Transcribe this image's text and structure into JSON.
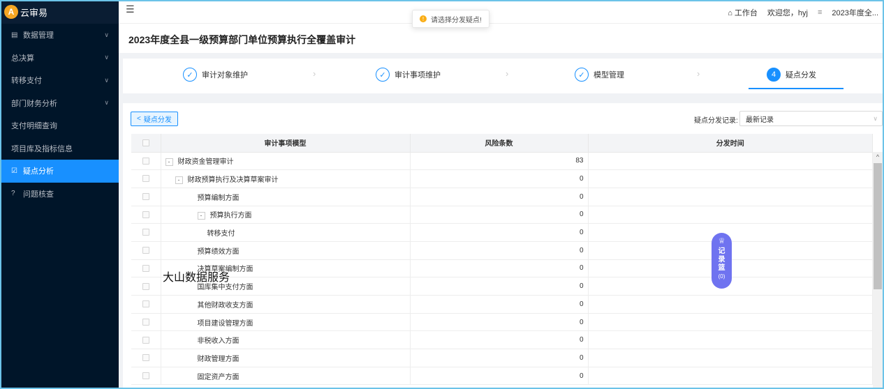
{
  "app": {
    "logo_text": "云审易"
  },
  "sidebar": {
    "items": [
      {
        "label": "数据管理",
        "icon": "▤",
        "has_children": true,
        "active": false
      },
      {
        "label": "总决算",
        "icon": "",
        "has_children": true,
        "active": false
      },
      {
        "label": "转移支付",
        "icon": "",
        "has_children": true,
        "active": false
      },
      {
        "label": "部门财务分析",
        "icon": "",
        "has_children": true,
        "active": false
      },
      {
        "label": "支付明细查询",
        "icon": "",
        "has_children": false,
        "active": false
      },
      {
        "label": "项目库及指标信息",
        "icon": "",
        "has_children": false,
        "active": false
      },
      {
        "label": "疑点分析",
        "icon": "☑",
        "has_children": false,
        "active": true
      },
      {
        "label": "问题核查",
        "icon": "?",
        "has_children": false,
        "active": false
      }
    ]
  },
  "topbar": {
    "workbench": "工作台",
    "welcome": "欢迎您，hyj",
    "year": "2023年度全..."
  },
  "toast": {
    "message": "请选择分发疑点!"
  },
  "page": {
    "title": "2023年度全县一级预算部门单位预算执行全覆盖审计"
  },
  "steps": [
    {
      "label": "审计对象维护",
      "marker": "✓",
      "active": false
    },
    {
      "label": "审计事项维护",
      "marker": "✓",
      "active": false
    },
    {
      "label": "模型管理",
      "marker": "✓",
      "active": false
    },
    {
      "label": "疑点分发",
      "marker": "4",
      "active": true
    }
  ],
  "toolbar": {
    "dispatch_button": "疑点分发",
    "record_label": "疑点分发记录:",
    "record_select_value": "最新记录"
  },
  "table": {
    "headers": [
      "审计事项模型",
      "风险条数",
      "分发时间"
    ],
    "rows": [
      {
        "name": "财政资金管理审计",
        "level": 0,
        "toggle": "-",
        "risk": "83",
        "time": ""
      },
      {
        "name": "财政预算执行及决算草案审计",
        "level": 1,
        "toggle": "-",
        "risk": "0",
        "time": ""
      },
      {
        "name": "预算编制方面",
        "level": 2,
        "toggle": "",
        "risk": "0",
        "time": ""
      },
      {
        "name": "预算执行方面",
        "level": 2,
        "toggle": "-",
        "risk": "0",
        "time": ""
      },
      {
        "name": "转移支付",
        "level": 3,
        "toggle": "",
        "risk": "0",
        "time": ""
      },
      {
        "name": "预算绩效方面",
        "level": 2,
        "toggle": "",
        "risk": "0",
        "time": ""
      },
      {
        "name": "决算草案编制方面",
        "level": 2,
        "toggle": "",
        "risk": "0",
        "time": ""
      },
      {
        "name": "国库集中支付方面",
        "level": 2,
        "toggle": "",
        "risk": "0",
        "time": ""
      },
      {
        "name": "其他财政收支方面",
        "level": 2,
        "toggle": "",
        "risk": "0",
        "time": ""
      },
      {
        "name": "项目建设管理方面",
        "level": 2,
        "toggle": "",
        "risk": "0",
        "time": ""
      },
      {
        "name": "非税收入方面",
        "level": 2,
        "toggle": "",
        "risk": "0",
        "time": ""
      },
      {
        "name": "财政管理方面",
        "level": 2,
        "toggle": "",
        "risk": "0",
        "time": ""
      },
      {
        "name": "固定资产方面",
        "level": 2,
        "toggle": "",
        "risk": "0",
        "time": ""
      }
    ]
  },
  "float_button": {
    "chars": [
      "记",
      "录",
      "篮"
    ],
    "count": "(0)"
  },
  "watermark": "大山数据服务"
}
